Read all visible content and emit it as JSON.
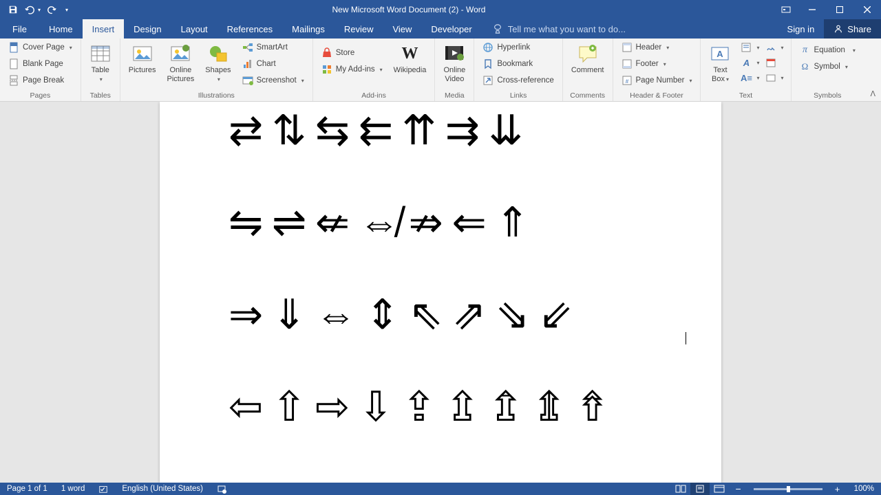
{
  "titlebar": {
    "title": "New Microsoft Word Document (2) - Word"
  },
  "tabs": {
    "file": "File",
    "home": "Home",
    "insert": "Insert",
    "design": "Design",
    "layout": "Layout",
    "references": "References",
    "mailings": "Mailings",
    "review": "Review",
    "view": "View",
    "developer": "Developer",
    "tellme": "Tell me what you want to do...",
    "signin": "Sign in",
    "share": "Share"
  },
  "ribbon": {
    "pages": {
      "label": "Pages",
      "cover": "Cover Page",
      "blank": "Blank Page",
      "break": "Page Break"
    },
    "tables": {
      "label": "Tables",
      "table": "Table"
    },
    "illustrations": {
      "label": "Illustrations",
      "pictures": "Pictures",
      "online": "Online Pictures",
      "shapes": "Shapes",
      "smartart": "SmartArt",
      "chart": "Chart",
      "screenshot": "Screenshot"
    },
    "addins": {
      "label": "Add-ins",
      "store": "Store",
      "myaddins": "My Add-ins",
      "wikipedia": "Wikipedia"
    },
    "media": {
      "label": "Media",
      "video": "Online Video"
    },
    "links": {
      "label": "Links",
      "hyperlink": "Hyperlink",
      "bookmark": "Bookmark",
      "crossref": "Cross-reference"
    },
    "comments": {
      "label": "Comments",
      "comment": "Comment"
    },
    "headerfooter": {
      "label": "Header & Footer",
      "header": "Header",
      "footer": "Footer",
      "pagenum": "Page Number"
    },
    "text": {
      "label": "Text",
      "textbox": "Text Box"
    },
    "symbols": {
      "label": "Symbols",
      "equation": "Equation",
      "symbol": "Symbol"
    }
  },
  "document": {
    "row1": "⇄ ⇅ ⇆ ⇇ ⇈ ⇉ ⇊",
    "row2": "⇋ ⇌ ⇍ ⇎ ⇏ ⇐ ⇑",
    "row3": "⇒ ⇓ ⇔ ⇕ ⇖ ⇗ ⇘ ⇙",
    "row4": "⇦ ⇧ ⇨ ⇩ ⇪ ⇫ ⇬ ⇭ ⇮"
  },
  "statusbar": {
    "page": "Page 1 of 1",
    "words": "1 word",
    "lang": "English (United States)",
    "zoom": "100%"
  }
}
